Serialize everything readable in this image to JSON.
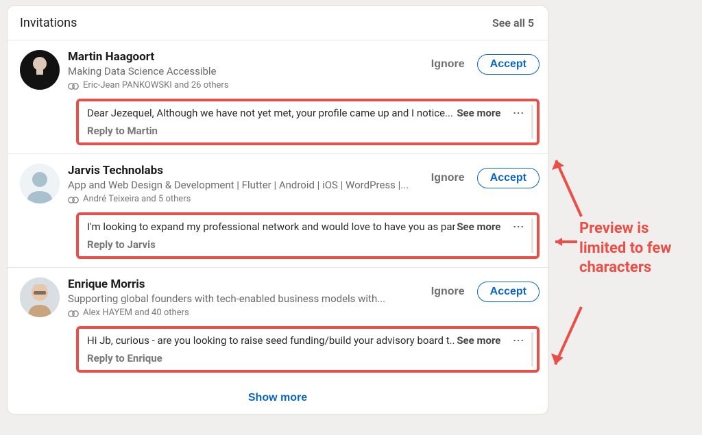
{
  "header": {
    "title": "Invitations",
    "see_all": "See all 5"
  },
  "invites": [
    {
      "name": "Martin Haagoort",
      "headline": "Making Data Science Accessible",
      "mutual": "Eric-Jean PANKOWSKI and 26 others",
      "ignore": "Ignore",
      "accept": "Accept",
      "message": "Dear Jezequel, Although we have not yet met, your profile came up and I notice...",
      "see_more": "See more",
      "reply": "Reply to Martin"
    },
    {
      "name": "Jarvis Technolabs",
      "headline": "App and Web Design & Development | Flutter | Android | iOS | WordPress |...",
      "mutual": "André Teixeira and 5 others",
      "ignore": "Ignore",
      "accept": "Accept",
      "message": "I'm looking to expand my professional network and would love to have you as par...",
      "see_more": "See more",
      "reply": "Reply to Jarvis"
    },
    {
      "name": "Enrique Morris",
      "headline": "Supporting global founders with tech-enabled business models with...",
      "mutual": "Alex HAYEM and 40 others",
      "ignore": "Ignore",
      "accept": "Accept",
      "message": "Hi Jb, curious - are you looking to raise seed funding/build your advisory board t...",
      "see_more": "See more",
      "reply": "Reply to Enrique"
    }
  ],
  "show_more": "Show more",
  "annotation": "Preview is limited to few characters"
}
